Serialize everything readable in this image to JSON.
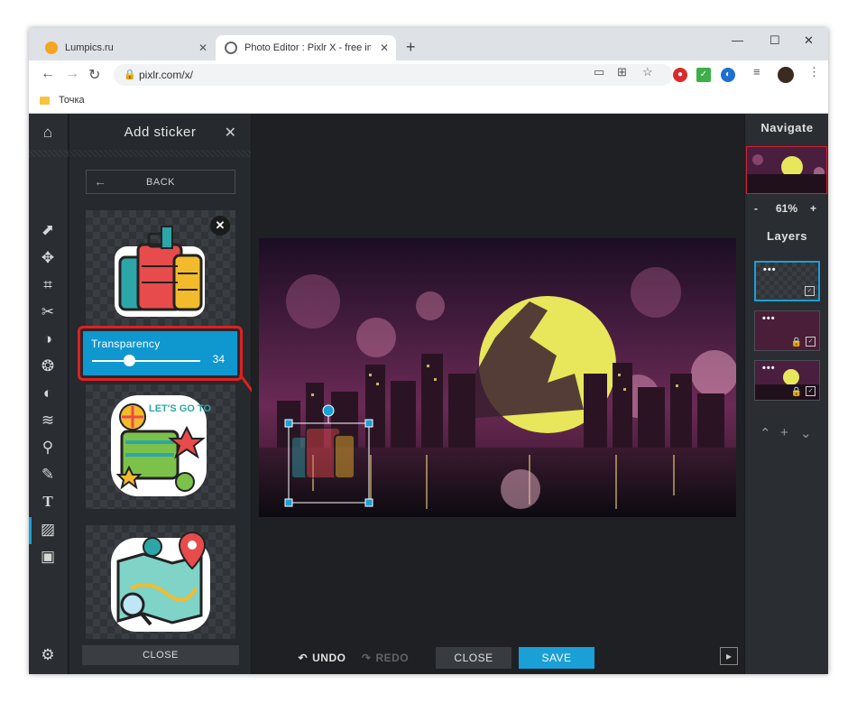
{
  "browser": {
    "tabs": [
      {
        "title": "Lumpics.ru",
        "favicon_color": "#f4a620"
      },
      {
        "title": "Photo Editor : Pixlr X - free image",
        "favicon_color": "#555555"
      }
    ],
    "url": "pixlr.com/x/",
    "bookmark": "Точка",
    "icons": {
      "back": "arrow-left-icon",
      "forward": "arrow-right-icon",
      "reload": "reload-icon",
      "minimize": "minimize-icon",
      "maximize": "maximize-icon",
      "close": "close-icon"
    }
  },
  "app": {
    "panel": {
      "title": "Add sticker",
      "back_label": "BACK",
      "close_label": "CLOSE",
      "transparency": {
        "label": "Transparency",
        "value": "34",
        "level": 0.34
      }
    },
    "workspace": {
      "undo_label": "UNDO",
      "redo_label": "REDO",
      "close_label": "CLOSE",
      "save_label": "SAVE"
    },
    "right": {
      "navigate_title": "Navigate",
      "zoom_minus": "-",
      "zoom_value": "61%",
      "zoom_plus": "+",
      "layers_title": "Layers",
      "layer_dots": "•••"
    },
    "colors": {
      "accent": "#1a9fd6",
      "highlight": "#e02020",
      "panel": "#26292d"
    }
  }
}
